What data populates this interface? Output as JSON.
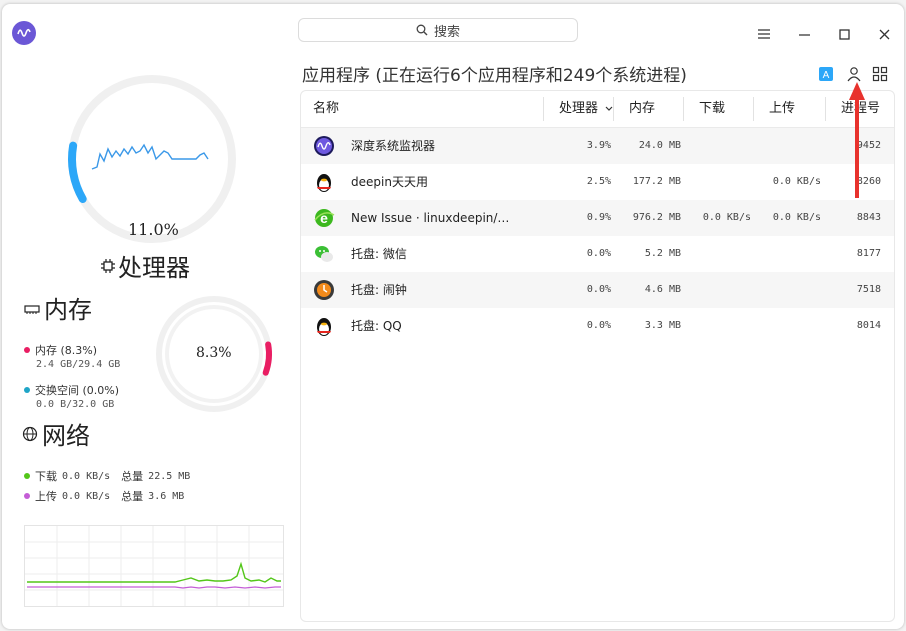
{
  "titlebar": {
    "search_label": "搜索",
    "menu_icon": "hamburger-menu-icon",
    "minimize_icon": "minimize-icon",
    "maximize_icon": "maximize-icon",
    "close_icon": "close-icon"
  },
  "cpu": {
    "value": "11.0%",
    "usage_fraction": 0.11,
    "title": "处理器"
  },
  "memory": {
    "title": "内存",
    "percent": "8.3%",
    "usage_fraction": 0.083,
    "mem_label": "内存 (8.3%)",
    "mem_detail": "2.4 GB/29.4 GB",
    "swap_label": "交换空间 (0.0%)",
    "swap_detail": "0.0 B/32.0 GB",
    "mem_color": "#e91e63",
    "swap_color": "#1fa5c7"
  },
  "network": {
    "title": "网络",
    "download_label": "下载",
    "download_speed": "0.0 KB/s",
    "download_total_label": "总量",
    "download_total": "22.5 MB",
    "upload_label": "上传",
    "upload_speed": "0.0 KB/s",
    "upload_total_label": "总量",
    "upload_total": "3.6 MB",
    "download_color": "#53c619",
    "upload_color": "#c45dd6"
  },
  "apps": {
    "title": "应用程序 (正在运行6个应用程序和249个系统进程)",
    "columns": {
      "name": "名称",
      "cpu": "处理器",
      "memory": "内存",
      "download": "下载",
      "upload": "上传",
      "pid": "进程号"
    },
    "rows": [
      {
        "icon": "deepin-monitor-icon",
        "name": "深度系统监视器",
        "cpu": "3.9%",
        "memory": "24.0 MB",
        "download": "",
        "upload": "",
        "pid": "9452"
      },
      {
        "icon": "qq-penguin-icon",
        "name": "deepin天天用",
        "cpu": "2.5%",
        "memory": "177.2 MB",
        "download": "",
        "upload": "0.0 KB/s",
        "pid": "8260"
      },
      {
        "icon": "browser-e-icon",
        "name": "New Issue · linuxdeepin/…",
        "cpu": "0.9%",
        "memory": "976.2 MB",
        "download": "0.0 KB/s",
        "upload": "0.0 KB/s",
        "pid": "8843"
      },
      {
        "icon": "wechat-icon",
        "name": "托盘: 微信",
        "cpu": "0.0%",
        "memory": "5.2 MB",
        "download": "",
        "upload": "",
        "pid": "8177"
      },
      {
        "icon": "alarm-clock-icon",
        "name": "托盘: 闹钟",
        "cpu": "0.0%",
        "memory": "4.6 MB",
        "download": "",
        "upload": "",
        "pid": "7518"
      },
      {
        "icon": "qq-penguin-icon",
        "name": "托盘: QQ",
        "cpu": "0.0%",
        "memory": "3.3 MB",
        "download": "",
        "upload": "",
        "pid": "8014"
      }
    ]
  },
  "accent_color": "#2ca7f8",
  "annotation_color": "#e8322d"
}
